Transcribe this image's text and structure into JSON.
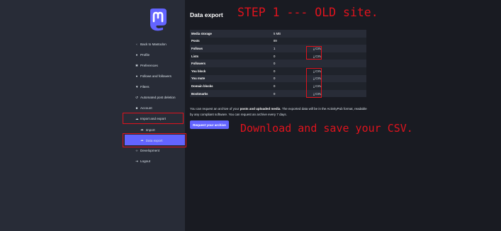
{
  "annotations": {
    "step": "STEP 1 --- OLD site.",
    "download": "Download and save your CSV."
  },
  "sidebar": {
    "items": [
      {
        "label": "Back to Mastodon",
        "icon": "chevron-left-icon"
      },
      {
        "label": "Profile",
        "icon": "user-icon"
      },
      {
        "label": "Preferences",
        "icon": "gear-icon"
      },
      {
        "label": "Follows and followers",
        "icon": "users-icon"
      },
      {
        "label": "Filters",
        "icon": "filter-icon"
      },
      {
        "label": "Automated post deletion",
        "icon": "history-icon"
      },
      {
        "label": "Account",
        "icon": "lock-icon"
      },
      {
        "label": "Import and export",
        "icon": "cloud-icon"
      },
      {
        "label": "Import",
        "icon": "cloud-upload-icon"
      },
      {
        "label": "Data export",
        "icon": "cloud-download-icon"
      },
      {
        "label": "Development",
        "icon": "code-icon"
      },
      {
        "label": "Logout",
        "icon": "sign-out-icon"
      }
    ]
  },
  "main": {
    "title": "Data export",
    "table": [
      {
        "label": "Media storage",
        "value": "5 MB",
        "csv": ""
      },
      {
        "label": "Posts",
        "value": "89",
        "csv": ""
      },
      {
        "label": "Follows",
        "value": "1",
        "csv": "CSV"
      },
      {
        "label": "Lists",
        "value": "0",
        "csv": "CSV"
      },
      {
        "label": "Followers",
        "value": "0",
        "csv": ""
      },
      {
        "label": "You block",
        "value": "0",
        "csv": "CSV"
      },
      {
        "label": "You mute",
        "value": "0",
        "csv": "CSV"
      },
      {
        "label": "Domain blocks",
        "value": "0",
        "csv": "CSV"
      },
      {
        "label": "Bookmarks",
        "value": "0",
        "csv": "CSV"
      }
    ],
    "description_part1": "You can request an archive of your ",
    "description_bold": "posts and uploaded media",
    "description_part2": ". The exported data will be in the ActivityPub format, readable by any compliant software. You can request an archive every 7 days.",
    "request_button": "Request your archive"
  },
  "colors": {
    "accent": "#6364ff",
    "annotation_red": "#e0131d",
    "sidebar_bg": "#282c37",
    "main_bg": "#191b22"
  }
}
